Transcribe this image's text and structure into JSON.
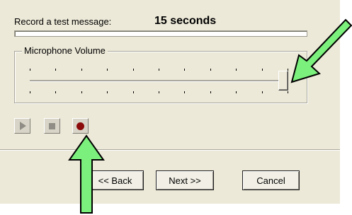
{
  "recording": {
    "label": "Record a test message:",
    "duration": "15 seconds",
    "progress_percent": 0
  },
  "microphone": {
    "group_title": "Microphone Volume",
    "volume_percent": 98
  },
  "controls": {
    "play_icon": "play-icon",
    "stop_icon": "stop-icon",
    "record_icon": "record-icon",
    "record_color": "#8b0a0a"
  },
  "buttons": {
    "back": "<< Back",
    "next": "Next >>",
    "cancel": "Cancel"
  },
  "annotations": {
    "arrow_color": "#7cf07c",
    "arrow_icons": [
      "arrow-to-volume-slider",
      "arrow-to-record-button"
    ]
  }
}
